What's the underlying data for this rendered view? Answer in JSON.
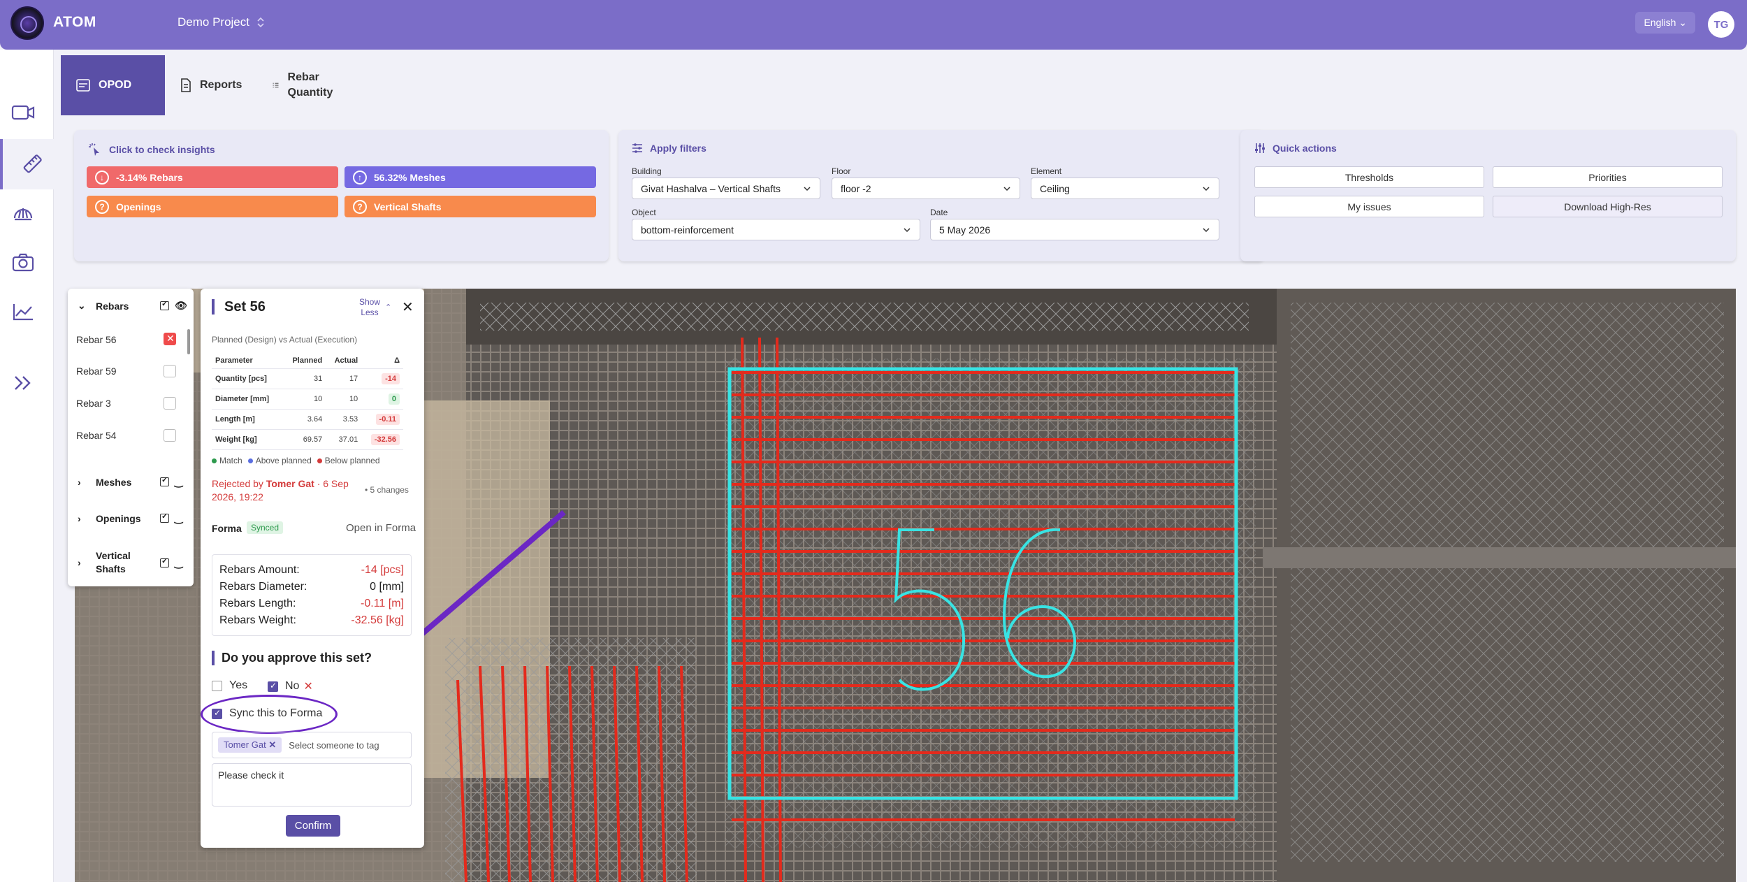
{
  "header": {
    "brand": "ATOM",
    "project": "Demo Project",
    "language": "English",
    "user_initials": "TG"
  },
  "sidebar": {
    "items": [
      {
        "icon": "video-icon"
      },
      {
        "icon": "ruler-icon",
        "active": true
      },
      {
        "icon": "gauge-icon"
      },
      {
        "icon": "camera-icon"
      },
      {
        "icon": "chart-line-icon"
      },
      {
        "icon": "expand-icon"
      }
    ]
  },
  "tabs": [
    {
      "label": "OPOD",
      "active": true
    },
    {
      "label": "Reports"
    },
    {
      "label": "Rebar Quantity"
    }
  ],
  "insights": {
    "title": "Click to check insights",
    "items": [
      {
        "label": "-3.14% Rebars",
        "color": "#f0696a"
      },
      {
        "label": "56.32% Meshes",
        "color": "#7569e2"
      },
      {
        "label": "Openings",
        "color": "#f88a4c"
      },
      {
        "label": "Vertical Shafts",
        "color": "#f88a4c"
      }
    ]
  },
  "filters": {
    "title": "Apply filters",
    "building_label": "Building",
    "building_value": "Givat Hashalva – Vertical Shafts",
    "floor_label": "Floor",
    "floor_value": "floor -2",
    "element_label": "Element",
    "element_value": "Ceiling",
    "object_label": "Object",
    "object_value": "bottom-reinforcement",
    "date_label": "Date",
    "date_value": "5 May 2026"
  },
  "quick_actions": {
    "title": "Quick actions",
    "buttons": [
      "Thresholds",
      "Priorities",
      "My issues",
      "Download High-Res"
    ]
  },
  "layers": {
    "rebars_label": "Rebars",
    "rebar_items": [
      "Rebar 56",
      "Rebar 59",
      "Rebar 3",
      "Rebar 54"
    ],
    "meshes_label": "Meshes",
    "openings_label": "Openings",
    "shafts_label": "Vertical Shafts"
  },
  "set_panel": {
    "title": "Set 56",
    "show_less": "Show Less",
    "subtitle": "Planned (Design) vs Actual (Execution)",
    "table_headers": [
      "Parameter",
      "Planned",
      "Actual",
      "Δ"
    ],
    "rows": [
      {
        "param": "Quantity [pcs]",
        "planned": "31",
        "actual": "17",
        "delta": "-14",
        "kind": "neg"
      },
      {
        "param": "Diameter [mm]",
        "planned": "10",
        "actual": "10",
        "delta": "0",
        "kind": "zero"
      },
      {
        "param": "Length [m]",
        "planned": "3.64",
        "actual": "3.53",
        "delta": "-0.11",
        "kind": "neg"
      },
      {
        "param": "Weight [kg]",
        "planned": "69.57",
        "actual": "37.01",
        "delta": "-32.56",
        "kind": "neg"
      }
    ],
    "legend": [
      "Match",
      "Above planned",
      "Below planned"
    ],
    "rejected_prefix": "Rejected by",
    "rejected_by": "Tomer Gat",
    "rejected_date": "· 6 Sep 2026, 19:22",
    "changes": "• 5 changes",
    "forma_label": "Forma",
    "synced_badge": "Synced",
    "open_in_forma": "Open in Forma",
    "summary": [
      {
        "label": "Rebars Amount:",
        "value": "-14 [pcs]",
        "neg": true
      },
      {
        "label": "Rebars Diameter:",
        "value": "0 [mm]",
        "neg": false
      },
      {
        "label": "Rebars Length:",
        "value": "-0.11 [m]",
        "neg": true
      },
      {
        "label": "Rebars Weight:",
        "value": "-32.56 [kg]",
        "neg": true
      }
    ],
    "question": "Do you approve this set?",
    "yes_label": "Yes",
    "no_label": "No",
    "sync_label": "Sync this to Forma",
    "tag_chip": "Tomer Gat",
    "tag_placeholder": "Select someone to tag",
    "note": "Please check it",
    "confirm": "Confirm"
  },
  "map": {
    "set_label": "56"
  }
}
